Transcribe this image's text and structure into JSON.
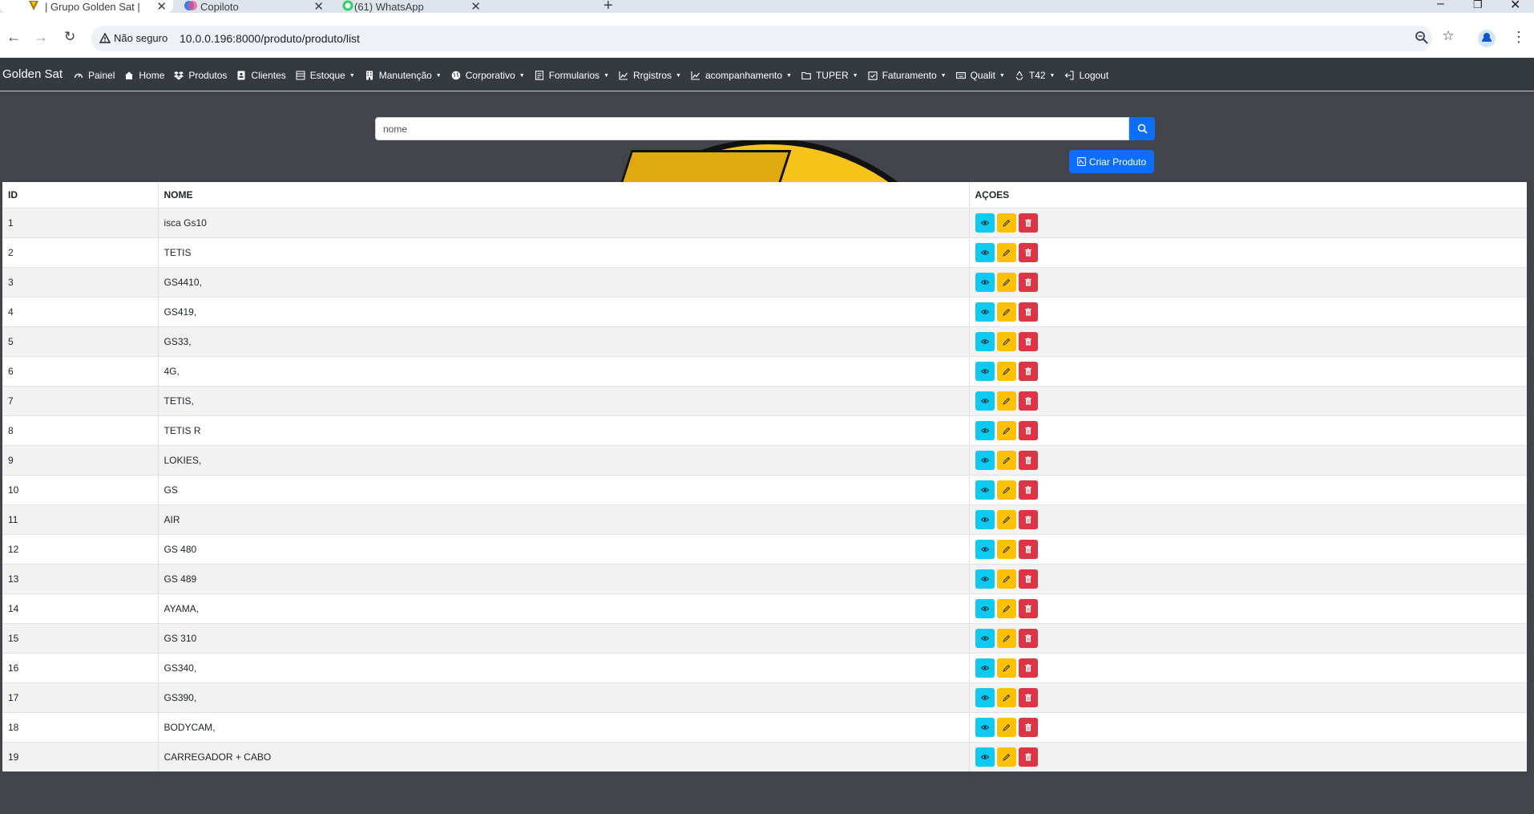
{
  "browser": {
    "tabs": [
      {
        "title": "| Grupo Golden Sat |",
        "active": true,
        "icon": "golden-sat-favicon"
      },
      {
        "title": "Copiloto",
        "active": false,
        "icon": "copilot-favicon"
      },
      {
        "title": "(61) WhatsApp",
        "active": false,
        "icon": "whatsapp-favicon"
      }
    ],
    "security_label": "Não seguro",
    "url": "10.0.0.196:8000/produto/produto/list"
  },
  "navbar": {
    "brand": "Golden Sat",
    "items": [
      {
        "label": "Painel",
        "icon": "gauge-icon",
        "dropdown": false
      },
      {
        "label": "Home",
        "icon": "home-icon",
        "dropdown": false
      },
      {
        "label": "Produtos",
        "icon": "dropbox-icon",
        "dropdown": false
      },
      {
        "label": "Clientes",
        "icon": "contact-icon",
        "dropdown": false
      },
      {
        "label": "Estoque",
        "icon": "list-icon",
        "dropdown": true
      },
      {
        "label": "Manutenção",
        "icon": "building-icon",
        "dropdown": true
      },
      {
        "label": "Corporativo",
        "icon": "globe-icon",
        "dropdown": true
      },
      {
        "label": "Formularios",
        "icon": "form-icon",
        "dropdown": true
      },
      {
        "label": "Rrgistros",
        "icon": "chart-line-icon",
        "dropdown": true
      },
      {
        "label": "acompanhamento",
        "icon": "chart-line-icon",
        "dropdown": true
      },
      {
        "label": "TUPER",
        "icon": "folder-icon",
        "dropdown": true
      },
      {
        "label": "Faturamento",
        "icon": "calendar-check-icon",
        "dropdown": true
      },
      {
        "label": "Qualit",
        "icon": "keyboard-icon",
        "dropdown": true
      },
      {
        "label": "T42",
        "icon": "recycle-icon",
        "dropdown": true
      },
      {
        "label": "Logout",
        "icon": "logout-icon",
        "dropdown": false
      }
    ]
  },
  "search": {
    "placeholder": "nome"
  },
  "create_button": "Criar Produto",
  "table": {
    "headers": [
      "ID",
      "NOME",
      "AÇOES"
    ],
    "rows": [
      {
        "id": "1",
        "nome": "isca Gs10"
      },
      {
        "id": "2",
        "nome": "TETIS"
      },
      {
        "id": "3",
        "nome": "GS4410,"
      },
      {
        "id": "4",
        "nome": "GS419,"
      },
      {
        "id": "5",
        "nome": "GS33,"
      },
      {
        "id": "6",
        "nome": "4G,"
      },
      {
        "id": "7",
        "nome": "TETIS,"
      },
      {
        "id": "8",
        "nome": "TETIS R"
      },
      {
        "id": "9",
        "nome": "LOKIES,"
      },
      {
        "id": "10",
        "nome": "GS"
      },
      {
        "id": "11",
        "nome": "AIR"
      },
      {
        "id": "12",
        "nome": "GS 480"
      },
      {
        "id": "13",
        "nome": "GS 489"
      },
      {
        "id": "14",
        "nome": "AYAMA,"
      },
      {
        "id": "15",
        "nome": "GS 310"
      },
      {
        "id": "16",
        "nome": "GS340,"
      },
      {
        "id": "17",
        "nome": "GS390,"
      },
      {
        "id": "18",
        "nome": "BODYCAM,"
      },
      {
        "id": "19",
        "nome": "CARREGADOR + CABO"
      }
    ]
  },
  "colors": {
    "view": "#0dcaf0",
    "edit": "#ffc107",
    "delete": "#dc3545",
    "primary": "#0d6efd",
    "navbar": "#343a40"
  }
}
